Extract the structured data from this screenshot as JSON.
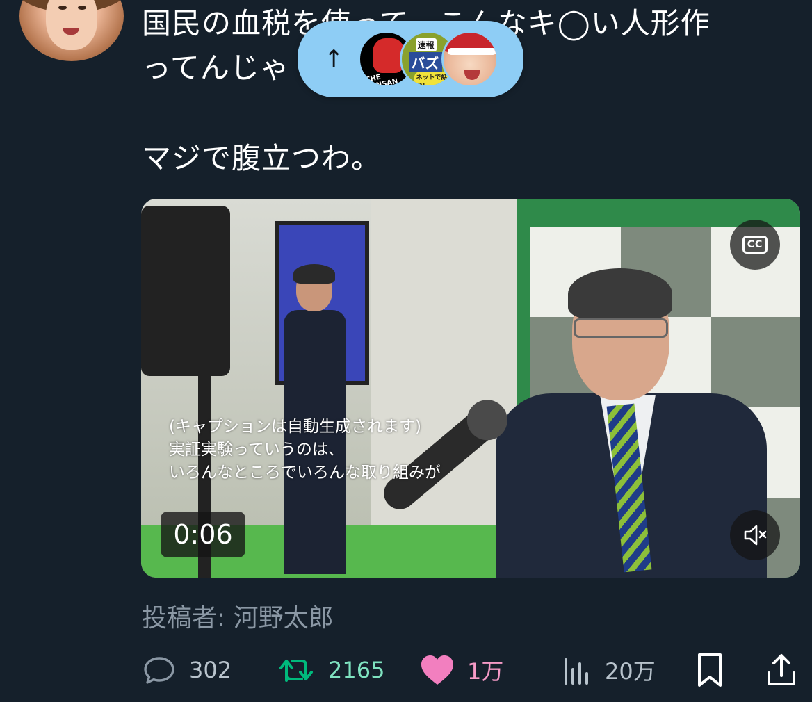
{
  "tweet": {
    "line1": "国民の血税を使って、こんなキ◯い人形作",
    "line2": "ってんじゃ",
    "line3": "マジで腹立つわ。"
  },
  "new_posts_pill": {
    "arrow": "↑",
    "avatar1_text": "CHE MINSAN",
    "avatar2_badge": "速報",
    "avatar2_title": "バズ",
    "avatar2_sub": "ネットで話題！"
  },
  "video": {
    "caption_lines": [
      "(キャプションは自動生成されます)",
      "実証実験っていうのは、",
      "いろんなところでいろんな取り組みが"
    ],
    "timer": "0:06",
    "cc_label": "CC"
  },
  "author_label": "投稿者: 河野太郎",
  "actions": {
    "replies": "302",
    "retweets": "2165",
    "likes": "1万",
    "views": "20万"
  },
  "colors": {
    "background": "#15202b",
    "retweet": "#00ba7c",
    "like": "#f91880",
    "muted": "#8b98a5",
    "pill": "#8ecdf5"
  }
}
